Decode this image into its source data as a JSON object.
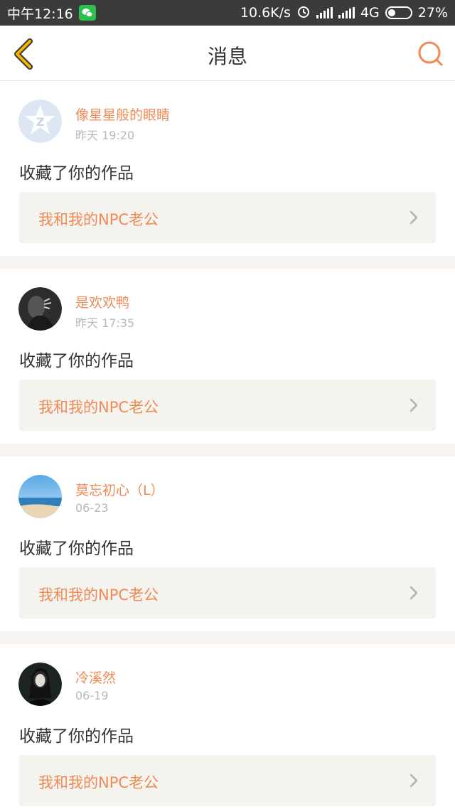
{
  "status_bar": {
    "time": "中午12:16",
    "speed": "10.6K/s",
    "network": "4G",
    "battery": "27%",
    "icons": [
      "wechat-icon",
      "alarm-icon",
      "signal-icon",
      "signal-icon",
      "battery-icon"
    ]
  },
  "header": {
    "title": "消息",
    "back_icon": "chevron-left-icon",
    "search_icon": "search-icon"
  },
  "colors": {
    "accent": "#ee8a55",
    "back_icon": "#f4b400",
    "card_box": "#f4f3ee"
  },
  "messages": [
    {
      "user": "像星星般的眼睛",
      "time": "昨天 19:20",
      "action": "收藏了你的作品",
      "work_title": "我和我的NPC老公"
    },
    {
      "user": "是欢欢鸭",
      "time": "昨天 17:35",
      "action": "收藏了你的作品",
      "work_title": "我和我的NPC老公"
    },
    {
      "user": "莫忘初心（L）",
      "time": "06-23",
      "action": "收藏了你的作品",
      "work_title": "我和我的NPC老公"
    },
    {
      "user": "冷溪然",
      "time": "06-19",
      "action": "收藏了你的作品",
      "work_title": "我和我的NPC老公"
    }
  ]
}
